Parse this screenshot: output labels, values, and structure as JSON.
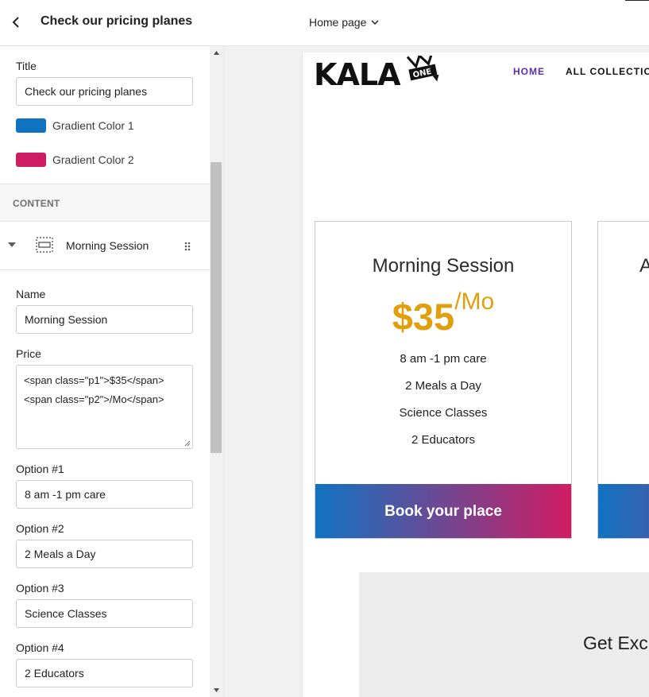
{
  "sidebar": {
    "title": "Check our pricing planes",
    "title_field": {
      "label": "Title",
      "value": "Check our pricing planes"
    },
    "colors": [
      {
        "label": "Gradient Color 1",
        "value": "#1073c2"
      },
      {
        "label": "Gradient Color 2",
        "value": "#d01c62"
      }
    ],
    "section_heading": "CONTENT",
    "block": {
      "label": "Morning Session",
      "icon": "section-block-icon"
    },
    "fields": {
      "name": {
        "label": "Name",
        "value": "Morning Session"
      },
      "price": {
        "label": "Price",
        "line1": "<span class=\"p1\">$35</span>",
        "line2": "<span class=\"p2\">/Mo</span>"
      },
      "option1": {
        "label": "Option #1",
        "value": "8 am -1 pm care"
      },
      "option2": {
        "label": "Option #2",
        "value": "2 Meals a Day"
      },
      "option3": {
        "label": "Option #3",
        "value": "Science Classes"
      },
      "option4": {
        "label": "Option #4",
        "value": "2 Educators"
      }
    }
  },
  "topbar": {
    "page_selector": "Home page"
  },
  "preview": {
    "logo_text": "KALA",
    "logo_badge": "ONE",
    "nav": {
      "home": "HOME",
      "all": "ALL COLLECTION"
    },
    "cards": [
      {
        "name": "Morning Session",
        "price_main": "$35",
        "price_sub": "/Mo",
        "options": [
          "8 am -1 pm care",
          "2 Meals a Day",
          "Science Classes",
          "2 Educators"
        ],
        "button": "Book your place"
      },
      {
        "name": "A"
      }
    ],
    "gray_text": "Get Exc"
  }
}
